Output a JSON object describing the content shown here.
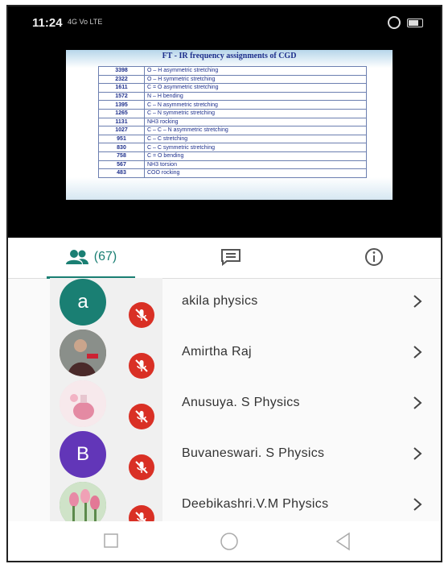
{
  "status": {
    "time": "11:24",
    "network": "4G Vo LTE"
  },
  "slide": {
    "title": "FT - IR  frequency assignments of CGD",
    "rows": [
      {
        "wavenumber": "3398",
        "assignment": "O – H asymmetric stretching"
      },
      {
        "wavenumber": "2322",
        "assignment": "O – H symmetric stretching"
      },
      {
        "wavenumber": "1611",
        "assignment": "C = O asymmetric stretching"
      },
      {
        "wavenumber": "1572",
        "assignment": "N – H bending"
      },
      {
        "wavenumber": "1395",
        "assignment": "C – N asymmetric stretching"
      },
      {
        "wavenumber": "1265",
        "assignment": "C – N symmetric stretching"
      },
      {
        "wavenumber": "1131",
        "assignment": "NH3 rocking"
      },
      {
        "wavenumber": "1027",
        "assignment": "C – C – N  asymmetric stretching"
      },
      {
        "wavenumber": "951",
        "assignment": "C – C stretching"
      },
      {
        "wavenumber": "830",
        "assignment": "C – C symmetric stretching"
      },
      {
        "wavenumber": "758",
        "assignment": "C = O bending"
      },
      {
        "wavenumber": "567",
        "assignment": "NH3 torsion"
      },
      {
        "wavenumber": "483",
        "assignment": "COO rocking"
      }
    ]
  },
  "tabs": {
    "people_count": "(67)",
    "people_icon": "people-icon",
    "chat_icon": "chat-icon",
    "info_icon": "info-icon"
  },
  "participants": [
    {
      "name": "akila physics",
      "avatar_letter": "a",
      "avatar_color": "#1a7f73",
      "muted": true
    },
    {
      "name": "Amirtha Raj",
      "avatar_letter": "",
      "avatar_color": "#7a5a4a",
      "muted": true
    },
    {
      "name": "Anusuya. S Physics",
      "avatar_letter": "",
      "avatar_color": "#f2d6dc",
      "muted": true
    },
    {
      "name": "Buvaneswari. S Physics",
      "avatar_letter": "B",
      "avatar_color": "#6236b8",
      "muted": true
    },
    {
      "name": "Deebikashri.V.M Physics",
      "avatar_letter": "",
      "avatar_color": "#7fa874",
      "muted": true
    }
  ],
  "colors": {
    "accent": "#1a7f73",
    "mute": "#d93025"
  }
}
